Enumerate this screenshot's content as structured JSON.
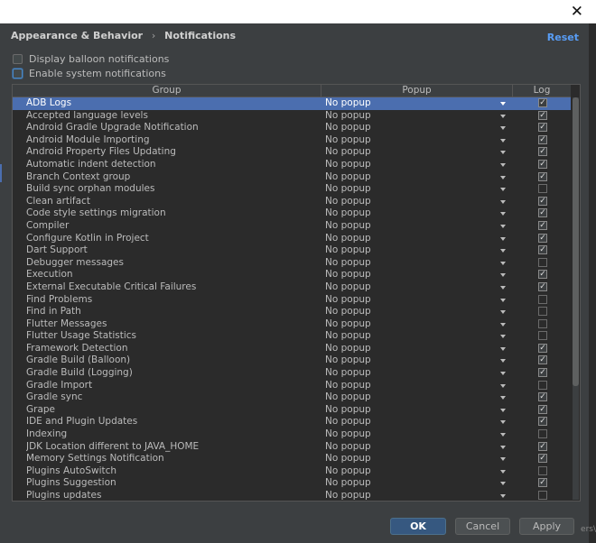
{
  "header": {
    "breadcrumb_parent": "Appearance & Behavior",
    "breadcrumb_separator": "›",
    "breadcrumb_current": "Notifications",
    "reset_label": "Reset",
    "close_glyph": "✕"
  },
  "options": {
    "balloon_label": "Display balloon notifications",
    "balloon_checked": false,
    "system_label": "Enable system notifications",
    "system_checked": false
  },
  "table": {
    "columns": {
      "group": "Group",
      "popup": "Popup",
      "log": "Log"
    },
    "selected_index": 0,
    "rows": [
      {
        "group": "ADB Logs",
        "popup": "No popup",
        "log": true
      },
      {
        "group": "Accepted language levels",
        "popup": "No popup",
        "log": true
      },
      {
        "group": "Android Gradle Upgrade Notification",
        "popup": "No popup",
        "log": true
      },
      {
        "group": "Android Module Importing",
        "popup": "No popup",
        "log": true
      },
      {
        "group": "Android Property Files Updating",
        "popup": "No popup",
        "log": true
      },
      {
        "group": "Automatic indent detection",
        "popup": "No popup",
        "log": true
      },
      {
        "group": "Branch Context group",
        "popup": "No popup",
        "log": true
      },
      {
        "group": "Build sync orphan modules",
        "popup": "No popup",
        "log": false
      },
      {
        "group": "Clean artifact",
        "popup": "No popup",
        "log": true
      },
      {
        "group": "Code style settings migration",
        "popup": "No popup",
        "log": true
      },
      {
        "group": "Compiler",
        "popup": "No popup",
        "log": true
      },
      {
        "group": "Configure Kotlin in Project",
        "popup": "No popup",
        "log": true
      },
      {
        "group": "Dart Support",
        "popup": "No popup",
        "log": true
      },
      {
        "group": "Debugger messages",
        "popup": "No popup",
        "log": false
      },
      {
        "group": "Execution",
        "popup": "No popup",
        "log": true
      },
      {
        "group": "External Executable Critical Failures",
        "popup": "No popup",
        "log": true
      },
      {
        "group": "Find Problems",
        "popup": "No popup",
        "log": false
      },
      {
        "group": "Find in Path",
        "popup": "No popup",
        "log": false
      },
      {
        "group": "Flutter Messages",
        "popup": "No popup",
        "log": false
      },
      {
        "group": "Flutter Usage Statistics",
        "popup": "No popup",
        "log": false
      },
      {
        "group": "Framework Detection",
        "popup": "No popup",
        "log": true
      },
      {
        "group": "Gradle Build (Balloon)",
        "popup": "No popup",
        "log": true
      },
      {
        "group": "Gradle Build (Logging)",
        "popup": "No popup",
        "log": true
      },
      {
        "group": "Gradle Import",
        "popup": "No popup",
        "log": false
      },
      {
        "group": "Gradle sync",
        "popup": "No popup",
        "log": true
      },
      {
        "group": "Grape",
        "popup": "No popup",
        "log": true
      },
      {
        "group": "IDE and Plugin Updates",
        "popup": "No popup",
        "log": true
      },
      {
        "group": "Indexing",
        "popup": "No popup",
        "log": false
      },
      {
        "group": "JDK Location different to JAVA_HOME",
        "popup": "No popup",
        "log": true
      },
      {
        "group": "Memory Settings Notification",
        "popup": "No popup",
        "log": true
      },
      {
        "group": "Plugins AutoSwitch",
        "popup": "No popup",
        "log": false
      },
      {
        "group": "Plugins Suggestion",
        "popup": "No popup",
        "log": true
      },
      {
        "group": "Plugins updates",
        "popup": "No popup",
        "log": false
      }
    ]
  },
  "buttons": {
    "ok": "OK",
    "cancel": "Cancel",
    "apply": "Apply"
  },
  "footer_hint": "ers\\"
}
